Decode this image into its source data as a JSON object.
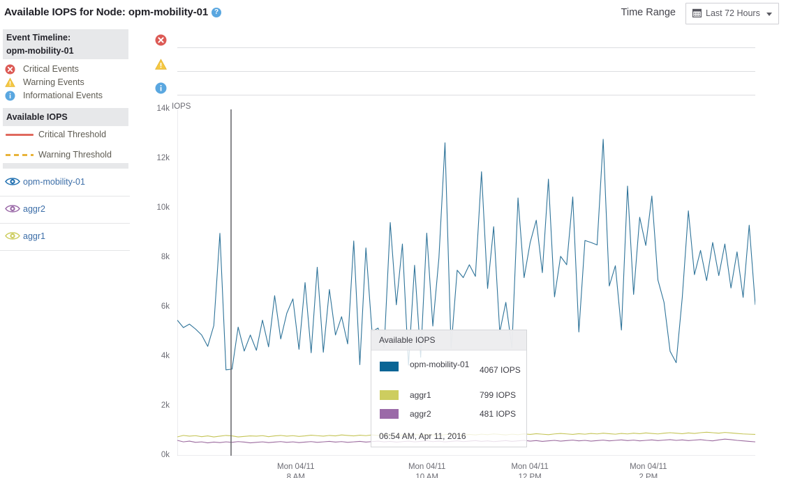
{
  "header": {
    "title": "Available IOPS for Node: opm-mobility-01",
    "help_icon": "help-circle-icon",
    "time_range_label": "Time Range",
    "time_range_value": "Last 72 Hours",
    "calendar_icon": "calendar-icon",
    "caret_icon": "chevron-down-icon"
  },
  "sidebar": {
    "event_timeline_title_line1": "Event Timeline:",
    "event_timeline_title_line2": "opm-mobility-01",
    "events": [
      {
        "label": "Critical Events",
        "icon": "critical-error-icon",
        "color": "#dc5a55"
      },
      {
        "label": "Warning Events",
        "icon": "warning-triangle-icon",
        "color": "#f5c842"
      },
      {
        "label": "Informational Events",
        "icon": "information-icon",
        "color": "#5aa7e0"
      }
    ],
    "metric_title": "Available IOPS",
    "thresholds": [
      {
        "label": "Critical Threshold",
        "style": "solid",
        "color": "#e0695e"
      },
      {
        "label": "Warning Threshold",
        "style": "dashed",
        "color": "#e8b33a"
      }
    ],
    "nodes": [
      {
        "label": "opm-mobility-01",
        "icon": "eye-visibility-icon",
        "color": "#1f6fb0"
      },
      {
        "label": "aggr2",
        "icon": "eye-visibility-icon",
        "color": "#9b6aa8"
      },
      {
        "label": "aggr1",
        "icon": "eye-visibility-icon",
        "color": "#cdcd5f"
      }
    ]
  },
  "tooltip": {
    "title": "Available IOPS",
    "rows": [
      {
        "name": "opm-mobility-01",
        "value": "4067 IOPS",
        "color": "#0a6595"
      },
      {
        "name": "aggr1",
        "value": "799 IOPS",
        "color": "#cdcd5f"
      },
      {
        "name": "aggr2",
        "value": "481 IOPS",
        "color": "#9b6aa8"
      }
    ],
    "timestamp": "06:54 AM, Apr 11, 2016"
  },
  "chart_data": {
    "type": "line",
    "title": "Available IOPS for Node: opm-mobility-01",
    "xlabel": "",
    "ylabel": "IOPS",
    "y_unit": "IOPS",
    "ylim": [
      0,
      14000
    ],
    "yticks": [
      0,
      2000,
      4000,
      6000,
      8000,
      10000,
      12000,
      14000
    ],
    "ytick_labels": [
      "0k",
      "2k",
      "4k",
      "6k",
      "8k",
      "10k",
      "12k",
      "14k"
    ],
    "grid": false,
    "legend_position": "left-sidebar",
    "xticks": [
      {
        "label_line1": "Mon 04/11",
        "label_line2": "8 AM",
        "pos": 0.205
      },
      {
        "label_line1": "Mon 04/11",
        "label_line2": "10 AM",
        "pos": 0.432
      },
      {
        "label_line1": "Mon 04/11",
        "label_line2": "12 PM",
        "pos": 0.61
      },
      {
        "label_line1": "Mon 04/11",
        "label_line2": "2 PM",
        "pos": 0.815
      }
    ],
    "cursor_line_x": 0.093,
    "cursor_color": "#6b6b70",
    "series": [
      {
        "name": "opm-mobility-01",
        "color": "#2e7399",
        "values": [
          5480,
          5180,
          5320,
          5120,
          4880,
          4420,
          5260,
          8990,
          3470,
          3500,
          5200,
          4230,
          4880,
          4260,
          5480,
          4400,
          6470,
          4720,
          5760,
          6340,
          4300,
          7000,
          4160,
          7620,
          4180,
          6720,
          4880,
          5620,
          4520,
          8680,
          3680,
          8400,
          5020,
          5160,
          4360,
          9430,
          6100,
          8560,
          3660,
          7700,
          3980,
          9000,
          5240,
          8000,
          12650,
          4340,
          7500,
          7200,
          7720,
          7250,
          11480,
          6760,
          9260,
          5000,
          6200,
          4360,
          10420,
          7200,
          8620,
          9520,
          7400,
          11180,
          6420,
          8060,
          7720,
          10460,
          5000,
          8700,
          8620,
          8520,
          12790,
          6860,
          7680,
          5080,
          10900,
          6520,
          9640,
          8500,
          10500,
          7100,
          6200,
          4220,
          3760,
          6400,
          9900,
          7320,
          8300,
          7080,
          8620,
          7280,
          8560,
          6780,
          8240,
          6400,
          9320,
          6100
        ]
      },
      {
        "name": "aggr1",
        "color": "#c4c455",
        "values": [
          760,
          820,
          790,
          810,
          770,
          800,
          760,
          790,
          820,
          800,
          760,
          780,
          800,
          790,
          810,
          770,
          800,
          820,
          790,
          810,
          780,
          800,
          830,
          810,
          790,
          820,
          800,
          840,
          820,
          800,
          830,
          810,
          840,
          820,
          850,
          830,
          810,
          840,
          820,
          850,
          830,
          860,
          840,
          820,
          850,
          870,
          850,
          830,
          860,
          840,
          870,
          850,
          880,
          860,
          840,
          870,
          850,
          880,
          860,
          890,
          870,
          850,
          880,
          900,
          880,
          860,
          890,
          870,
          900,
          880,
          910,
          890,
          870,
          900,
          880,
          910,
          890,
          920,
          900,
          880,
          910,
          930,
          910,
          890,
          920,
          900,
          930,
          950,
          930,
          910,
          940,
          920,
          900,
          880,
          870,
          860
        ]
      },
      {
        "name": "aggr2",
        "color": "#9b6a9e",
        "values": [
          620,
          560,
          590,
          540,
          560,
          520,
          550,
          530,
          560,
          540,
          570,
          550,
          520,
          540,
          560,
          530,
          550,
          570,
          540,
          560,
          530,
          550,
          570,
          540,
          560,
          580,
          550,
          570,
          540,
          560,
          580,
          550,
          570,
          590,
          560,
          580,
          550,
          570,
          590,
          560,
          580,
          600,
          570,
          590,
          560,
          580,
          600,
          570,
          590,
          610,
          580,
          600,
          570,
          590,
          610,
          580,
          600,
          620,
          590,
          610,
          580,
          600,
          620,
          590,
          610,
          630,
          600,
          620,
          590,
          610,
          630,
          600,
          620,
          640,
          610,
          630,
          600,
          620,
          640,
          610,
          630,
          650,
          620,
          640,
          610,
          630,
          650,
          620,
          600,
          640,
          670,
          650,
          620,
          600,
          580,
          560
        ]
      }
    ]
  },
  "event_tracks": [
    {
      "icon": "critical-error-icon",
      "label": "Critical Events"
    },
    {
      "icon": "warning-triangle-icon",
      "label": "Warning Events"
    },
    {
      "icon": "information-icon",
      "label": "Informational Events"
    }
  ]
}
